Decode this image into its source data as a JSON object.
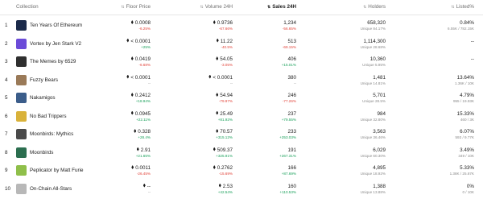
{
  "header": {
    "collection": "Collection",
    "floor": "Floor Price",
    "volume": "Volume 24H",
    "sales": "Sales 24H",
    "holders": "Holders",
    "listed": "Listed%"
  },
  "rows": [
    {
      "rank": "1",
      "name": "Ten Years Of Ethereum",
      "floor": "0.0008",
      "floor_chg": "-6.25%",
      "floor_dir": "neg",
      "vol": "0.9736",
      "vol_chg": "-67.66%",
      "vol_dir": "neg",
      "sales": "1,234",
      "sales_chg": "-56.65%",
      "sales_dir": "neg",
      "holders": "658,320",
      "unique": "Unique 84.17%",
      "listed": "0.84%",
      "listed_sub": "6.55K / 782.15K",
      "thumb": "#1b2a4a"
    },
    {
      "rank": "2",
      "name": "Vortex by Jen Stark V2",
      "floor": "< 0.0001",
      "floor_chg": "+25%",
      "floor_dir": "pos",
      "vol": "11.22",
      "vol_chg": "-40.5%",
      "vol_dir": "neg",
      "sales": "513",
      "sales_chg": "-69.15%",
      "sales_dir": "neg",
      "holders": "1,114,300",
      "unique": "Unique 28.68%",
      "listed": "--",
      "listed_sub": "",
      "thumb": "#6b4bd8"
    },
    {
      "rank": "3",
      "name": "The Memes by 6529",
      "floor": "0.0419",
      "floor_chg": "-6.68%",
      "floor_dir": "neg",
      "vol": "54.05",
      "vol_chg": "-3.05%",
      "vol_dir": "neg",
      "sales": "406",
      "sales_chg": "+15.01%",
      "sales_dir": "pos",
      "holders": "10,360",
      "unique": "Unique 5.95%",
      "listed": "--",
      "listed_sub": "",
      "thumb": "#2f2f2f"
    },
    {
      "rank": "4",
      "name": "Fuzzy Bears",
      "floor": "< 0.0001",
      "floor_chg": "--",
      "floor_dir": "grey",
      "vol": "< 0.0001",
      "vol_chg": "--",
      "vol_dir": "grey",
      "sales": "380",
      "sales_chg": "--",
      "sales_dir": "grey",
      "holders": "1,481",
      "unique": "Unique 14.81%",
      "listed": "13.64%",
      "listed_sub": "1.36K / 10K",
      "thumb": "#9a7a58"
    },
    {
      "rank": "5",
      "name": "Nakamigos",
      "floor": "0.2412",
      "floor_chg": "+18.94%",
      "floor_dir": "pos",
      "vol": "54.94",
      "vol_chg": "-79.97%",
      "vol_dir": "neg",
      "sales": "246",
      "sales_chg": "-77.26%",
      "sales_dir": "neg",
      "holders": "5,701",
      "unique": "Unique 28.5%",
      "listed": "4.79%",
      "listed_sub": "955 / 19.93K",
      "thumb": "#3b5d8a"
    },
    {
      "rank": "6",
      "name": "No Bad Trippers",
      "floor": "0.0945",
      "floor_chg": "+22.11%",
      "floor_dir": "pos",
      "vol": "25.49",
      "vol_chg": "+81.92%",
      "vol_dir": "pos",
      "sales": "237",
      "sales_chg": "+79.55%",
      "sales_dir": "pos",
      "holders": "984",
      "unique": "Unique 32.80%",
      "listed": "15.33%",
      "listed_sub": "460 / 3K",
      "thumb": "#d9b23a"
    },
    {
      "rank": "7",
      "name": "Moonbirds: Mythics",
      "floor": "0.328",
      "floor_chg": "+28.4%",
      "floor_dir": "pos",
      "vol": "70.57",
      "vol_chg": "+315.12%",
      "vol_dir": "pos",
      "sales": "233",
      "sales_chg": "+253.03%",
      "sales_dir": "pos",
      "holders": "3,563",
      "unique": "Unique 36.46%",
      "listed": "6.07%",
      "listed_sub": "593 / 9.77K",
      "thumb": "#4a4a4a"
    },
    {
      "rank": "8",
      "name": "Moonbirds",
      "floor": "2.91",
      "floor_chg": "+21.65%",
      "floor_dir": "pos",
      "vol": "509.37",
      "vol_chg": "+325.91%",
      "vol_dir": "pos",
      "sales": "191",
      "sales_chg": "+267.31%",
      "sales_dir": "pos",
      "holders": "6,029",
      "unique": "Unique 60.30%",
      "listed": "3.49%",
      "listed_sub": "349 / 10K",
      "thumb": "#2b6e4f"
    },
    {
      "rank": "9",
      "name": "Peplicator by Matt Furie",
      "floor": "0.0011",
      "floor_chg": "-26.45%",
      "floor_dir": "neg",
      "vol": "0.2762",
      "vol_chg": "-15.69%",
      "vol_dir": "neg",
      "sales": "166",
      "sales_chg": "+87.69%",
      "sales_dir": "pos",
      "holders": "4,895",
      "unique": "Unique 18.92%",
      "listed": "5.33%",
      "listed_sub": "1.38K / 25.87K",
      "thumb": "#8fbf4a"
    },
    {
      "rank": "10",
      "name": "On-Chain All-Stars",
      "floor": "--",
      "floor_chg": "--",
      "floor_dir": "grey",
      "vol": "2.53",
      "vol_chg": "+42.54%",
      "vol_dir": "pos",
      "sales": "160",
      "sales_chg": "+110.53%",
      "sales_dir": "pos",
      "holders": "1,388",
      "unique": "Unique 13.88%",
      "listed": "0%",
      "listed_sub": "0 / 10K",
      "thumb": "#b8b8b8"
    }
  ]
}
